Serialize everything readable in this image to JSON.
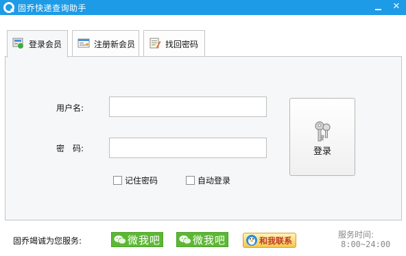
{
  "window": {
    "title": "固乔快递查询助手",
    "minimize_label": "",
    "close_label": "✕"
  },
  "tabs": [
    {
      "label": "登录会员",
      "active": true
    },
    {
      "label": "注册新会员",
      "active": false
    },
    {
      "label": "找回密码",
      "active": false
    }
  ],
  "login_form": {
    "username_label": "用户名:",
    "username_value": "",
    "password_label": "密　码:",
    "password_value": "",
    "login_button_label": "登录",
    "remember_password_label": "记住密码",
    "remember_password_checked": false,
    "auto_login_label": "自动登录",
    "auto_login_checked": false
  },
  "footer": {
    "service_label": "固乔竭诚为您服务:",
    "wechat_button_1": "微我吧",
    "wechat_button_2": "微我吧",
    "contact_button": "和我联系",
    "service_time_label": "服务时间:",
    "service_time_value": "8:00~24:00"
  },
  "colors": {
    "title_bar": "#1e9be6",
    "wechat_green": "#5cb833",
    "contact_gold": "#f5c84a"
  }
}
